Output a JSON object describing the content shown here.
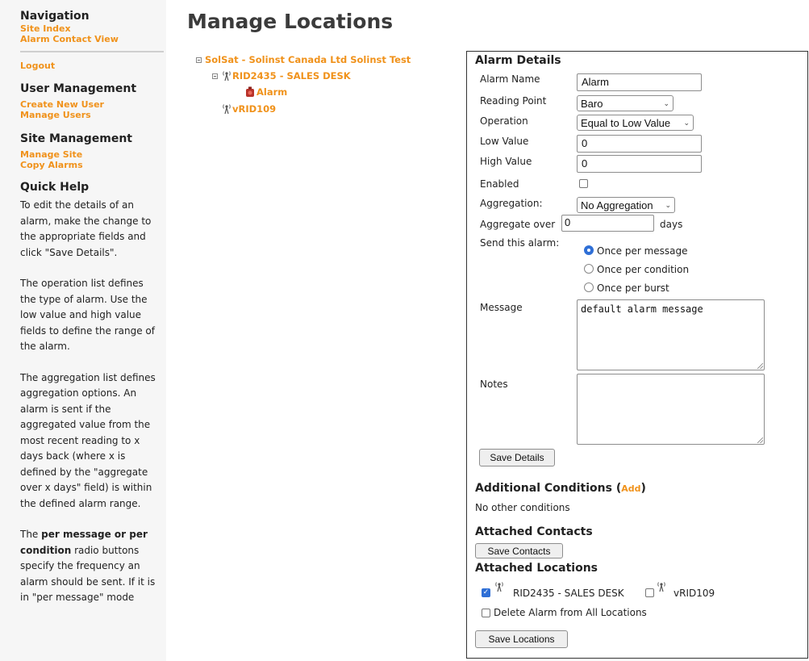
{
  "sidebar": {
    "nav_heading": "Navigation",
    "nav_links": [
      "Site Index",
      "Alarm Contact View"
    ],
    "logout": "Logout",
    "user_mgmt_heading": "User Management",
    "user_mgmt_links": [
      "Create New User",
      "Manage Users"
    ],
    "site_mgmt_heading": "Site Management",
    "site_mgmt_links": [
      "Manage Site",
      "Copy Alarms"
    ],
    "quick_help_heading": "Quick Help",
    "help_p1": "To edit the details of an alarm, make the change to the appropriate fields and click \"Save Details\".",
    "help_p2": "The operation list defines the type of alarm. Use the low value and high value fields to define the range of the alarm.",
    "help_p3": "The aggregation list defines aggregation options. An alarm is sent if the aggregated value from the most recent reading to x days back (where x is defined by the \"aggregate over x days\" field) is within the defined alarm range.",
    "help_p4_bold": "per message or per condition",
    "help_p4_pre": "The ",
    "help_p4_post": " radio buttons specify the frequency an alarm should be sent. If it is in \"per message\" mode"
  },
  "page_title": "Manage Locations",
  "tree": {
    "root": "SolSat - Solinst Canada Ltd Solinst Test",
    "station": "RID2435 - SALES DESK",
    "alarm": "Alarm",
    "station2": "vRID109"
  },
  "alarm_details": {
    "heading": "Alarm Details",
    "alarm_name_label": "Alarm Name",
    "alarm_name_value": "Alarm",
    "reading_point_label": "Reading Point",
    "reading_point_value": "Baro",
    "operation_label": "Operation",
    "operation_value": "Equal to Low Value",
    "low_value_label": "Low Value",
    "low_value": "0",
    "high_value_label": "High Value",
    "high_value": "0",
    "enabled_label": "Enabled",
    "enabled": false,
    "aggregation_label": "Aggregation:",
    "aggregation_value": "No Aggregation",
    "aggregate_over_label": "Aggregate over",
    "aggregate_over_value": "0",
    "days_label": "days",
    "send_label": "Send this alarm:",
    "send_options": [
      "Once per message",
      "Once per condition",
      "Once per burst"
    ],
    "send_selected": 0,
    "message_label": "Message",
    "message_value": "default alarm message",
    "notes_label": "Notes",
    "notes_value": "",
    "save_details": "Save Details"
  },
  "additional_conditions": {
    "heading": "Additional Conditions (",
    "add_link": "Add",
    "heading_close": ")",
    "none_text": "No other conditions"
  },
  "attached_contacts": {
    "heading": "Attached Contacts",
    "save_button": "Save Contacts"
  },
  "attached_locations": {
    "heading": "Attached Locations",
    "loc1": "RID2435 - SALES DESK",
    "loc1_checked": true,
    "loc2": "vRID109",
    "loc2_checked": false,
    "delete_label": "Delete Alarm from All Locations",
    "save_button": "Save Locations"
  },
  "colors": {
    "link": "#f0921b",
    "accent": "#2f6fd6",
    "sidebar_bg": "#f6f6f6"
  }
}
